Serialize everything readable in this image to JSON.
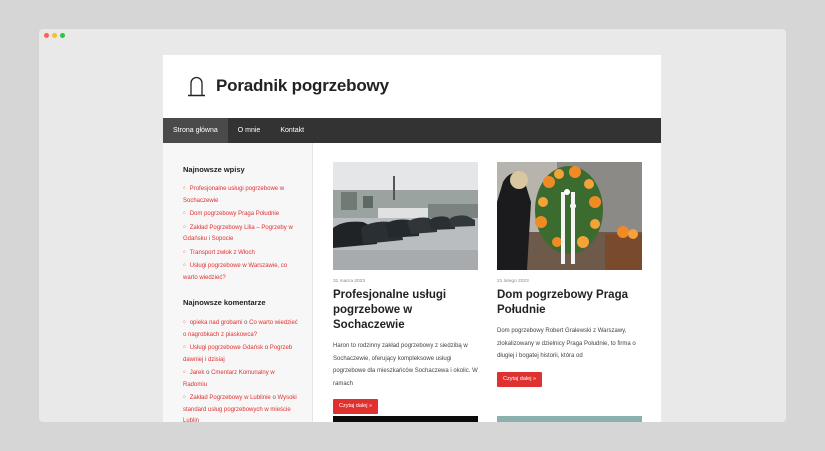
{
  "window": {
    "dots": [
      "#ff5f57",
      "#febc2e",
      "#28c840"
    ]
  },
  "site": {
    "title": "Poradnik pogrzebowy",
    "logo_icon": "tombstone-icon"
  },
  "nav": {
    "items": [
      "Strona główna",
      "O mnie",
      "Kontakt"
    ],
    "active": 0
  },
  "sidebar": {
    "recent_posts": {
      "title": "Najnowsze wpisy",
      "items": [
        "Profesjonalne usługi pogrzebowe w Sochaczewie",
        "Dom pogrzebowy Praga Południe",
        "Zakład Pogrzebowy Lilia – Pogrzeby w Gdańsku i Sopocie",
        "Transport zwłok z Włoch",
        "Usługi pogrzebowe w Warszawie, co warto wiedzieć?"
      ]
    },
    "recent_comments": {
      "title": "Najnowsze komentarze",
      "connector": "o",
      "items": [
        {
          "author": "opieka nad grobami",
          "post": "Co warto wiedzieć o nagrobkach z piaskowca?"
        },
        {
          "author": "Usługi pogrzebowe Gdańsk",
          "post": "Pogrzeb dawniej i dzisiaj"
        },
        {
          "author": "Jarek",
          "post": "Cmentarz Komunalny w Radomiu"
        },
        {
          "author": "Zakład Pogrzebowy w Lublinie",
          "post": "Wysoki standard usług pogrzebowych w mieście Lublin"
        }
      ]
    }
  },
  "posts": [
    {
      "date": "31 marca 2023",
      "title": "Profesjonalne usługi pogrzebowe w Sochaczewie",
      "excerpt": "Haron to rodzinny zakład pogrzebowy z siedzibą w Sochaczewie, oferujący kompleksowe usługi pogrzebowe dla mieszkańców Sochaczewa i okolic. W ramach",
      "button": "Czytaj dalej »"
    },
    {
      "date": "21 lutego 2023",
      "title": "Dom pogrzebowy Praga Południe",
      "excerpt": "Dom pogrzebowy Robert Gralewski z Warszawy, zlokalizowany w dzielnicy Praga Południe, to firma o długiej i bogatej historii, która od",
      "button": "Czytaj dalej »"
    }
  ],
  "colors": {
    "accent": "#e03131",
    "nav_bg": "#333333",
    "sidebar_bg": "#f7f7f7"
  }
}
